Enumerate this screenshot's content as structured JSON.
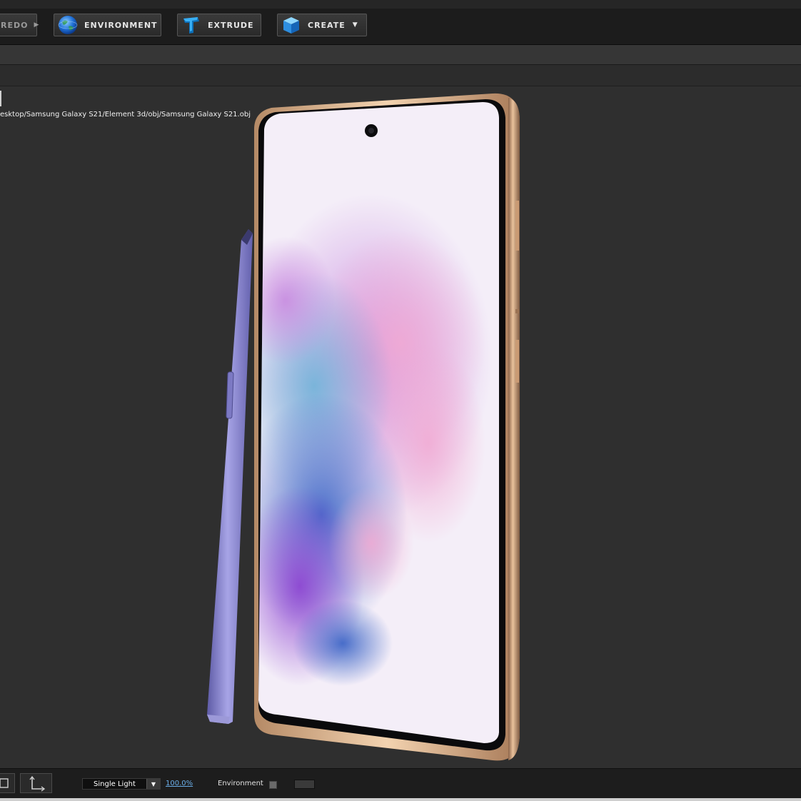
{
  "toolbar": {
    "redo_label": "REDO",
    "environment_label": "ENVIRONMENT",
    "extrude_label": "EXTRUDE",
    "create_label": "CREATE"
  },
  "viewport": {
    "model_path": "esktop/Samsung Galaxy S21/Element 3d/obj/Samsung Galaxy S21.obj"
  },
  "statusbar": {
    "light_mode": "Single Light",
    "zoom": "100.0%",
    "environment_label": "Environment"
  },
  "icons": {
    "environment": "globe-icon",
    "extrude": "extrude-t-icon",
    "create": "cube-icon"
  },
  "colors": {
    "phone_frame": "#d4a57c",
    "stylus": "#8e8bd0",
    "zoom_link": "#6aaee8"
  }
}
